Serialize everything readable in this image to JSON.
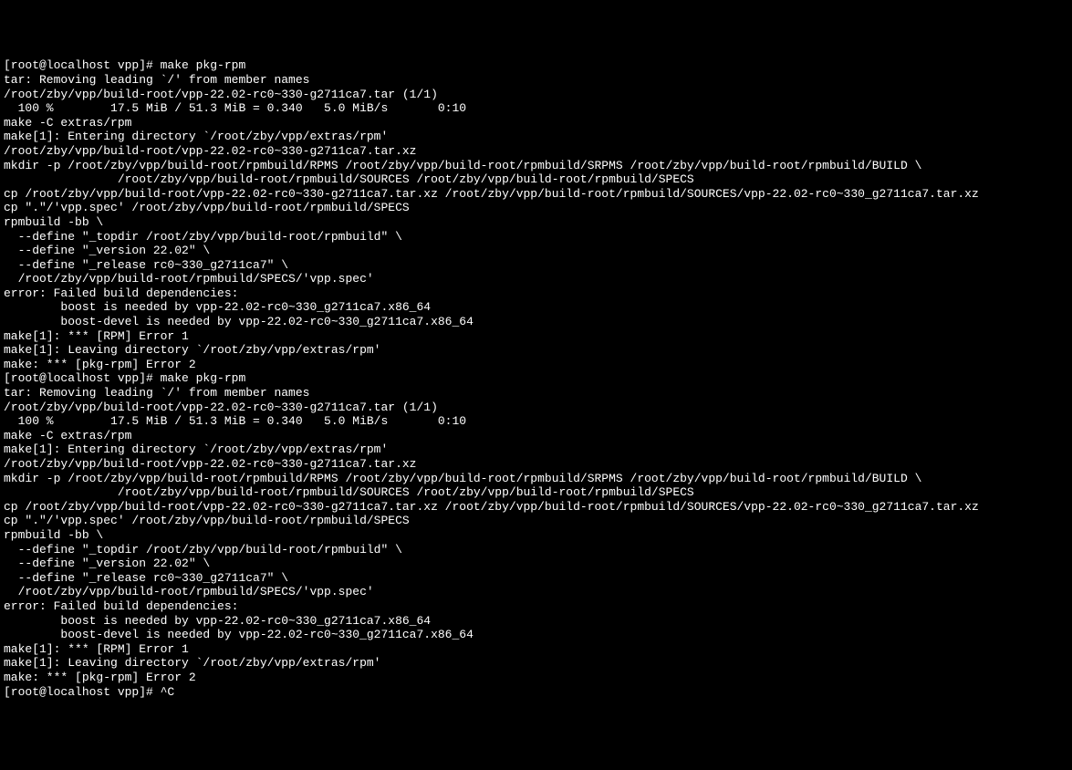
{
  "terminal": {
    "lines": [
      "[root@localhost vpp]# make pkg-rpm",
      "tar: Removing leading `/' from member names",
      "/root/zby/vpp/build-root/vpp-22.02-rc0~330-g2711ca7.tar (1/1)",
      "  100 %        17.5 MiB / 51.3 MiB = 0.340   5.0 MiB/s       0:10",
      "make -C extras/rpm",
      "make[1]: Entering directory `/root/zby/vpp/extras/rpm'",
      "/root/zby/vpp/build-root/vpp-22.02-rc0~330-g2711ca7.tar.xz",
      "mkdir -p /root/zby/vpp/build-root/rpmbuild/RPMS /root/zby/vpp/build-root/rpmbuild/SRPMS /root/zby/vpp/build-root/rpmbuild/BUILD \\",
      "                /root/zby/vpp/build-root/rpmbuild/SOURCES /root/zby/vpp/build-root/rpmbuild/SPECS",
      "cp /root/zby/vpp/build-root/vpp-22.02-rc0~330-g2711ca7.tar.xz /root/zby/vpp/build-root/rpmbuild/SOURCES/vpp-22.02-rc0~330_g2711ca7.tar.xz",
      "cp \".\"/'vpp.spec' /root/zby/vpp/build-root/rpmbuild/SPECS",
      "rpmbuild -bb \\",
      "  --define \"_topdir /root/zby/vpp/build-root/rpmbuild\" \\",
      "  --define \"_version 22.02\" \\",
      "  --define \"_release rc0~330_g2711ca7\" \\",
      "  /root/zby/vpp/build-root/rpmbuild/SPECS/'vpp.spec'",
      "error: Failed build dependencies:",
      "        boost is needed by vpp-22.02-rc0~330_g2711ca7.x86_64",
      "        boost-devel is needed by vpp-22.02-rc0~330_g2711ca7.x86_64",
      "make[1]: *** [RPM] Error 1",
      "make[1]: Leaving directory `/root/zby/vpp/extras/rpm'",
      "make: *** [pkg-rpm] Error 2",
      "[root@localhost vpp]# make pkg-rpm",
      "tar: Removing leading `/' from member names",
      "/root/zby/vpp/build-root/vpp-22.02-rc0~330-g2711ca7.tar (1/1)",
      "  100 %        17.5 MiB / 51.3 MiB = 0.340   5.0 MiB/s       0:10",
      "make -C extras/rpm",
      "make[1]: Entering directory `/root/zby/vpp/extras/rpm'",
      "/root/zby/vpp/build-root/vpp-22.02-rc0~330-g2711ca7.tar.xz",
      "mkdir -p /root/zby/vpp/build-root/rpmbuild/RPMS /root/zby/vpp/build-root/rpmbuild/SRPMS /root/zby/vpp/build-root/rpmbuild/BUILD \\",
      "                /root/zby/vpp/build-root/rpmbuild/SOURCES /root/zby/vpp/build-root/rpmbuild/SPECS",
      "cp /root/zby/vpp/build-root/vpp-22.02-rc0~330-g2711ca7.tar.xz /root/zby/vpp/build-root/rpmbuild/SOURCES/vpp-22.02-rc0~330_g2711ca7.tar.xz",
      "cp \".\"/'vpp.spec' /root/zby/vpp/build-root/rpmbuild/SPECS",
      "rpmbuild -bb \\",
      "  --define \"_topdir /root/zby/vpp/build-root/rpmbuild\" \\",
      "  --define \"_version 22.02\" \\",
      "  --define \"_release rc0~330_g2711ca7\" \\",
      "  /root/zby/vpp/build-root/rpmbuild/SPECS/'vpp.spec'",
      "error: Failed build dependencies:",
      "        boost is needed by vpp-22.02-rc0~330_g2711ca7.x86_64",
      "        boost-devel is needed by vpp-22.02-rc0~330_g2711ca7.x86_64",
      "make[1]: *** [RPM] Error 1",
      "make[1]: Leaving directory `/root/zby/vpp/extras/rpm'",
      "make: *** [pkg-rpm] Error 2",
      "[root@localhost vpp]# ^C"
    ]
  }
}
